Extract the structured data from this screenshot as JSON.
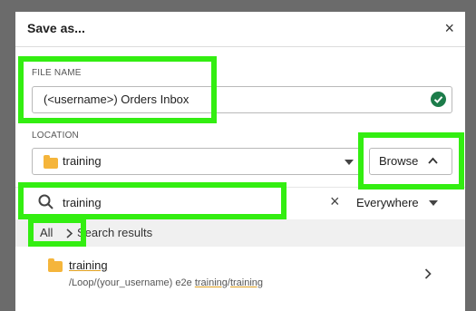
{
  "dialog": {
    "title": "Save as...",
    "close_glyph": "×"
  },
  "file_name": {
    "label": "FILE NAME",
    "value": "(<username>) Orders Inbox",
    "valid_icon": "check-circle-icon"
  },
  "location": {
    "label": "LOCATION",
    "value": "training",
    "browse_label": "Browse"
  },
  "search": {
    "query": "training",
    "clear_glyph": "×",
    "scope_value": "Everywhere"
  },
  "results": {
    "breadcrumb_all": "All",
    "breadcrumb_label": "Search results"
  },
  "result_item": {
    "name": "training",
    "path_prefix": "/Loop/(your_username) e2e ",
    "path_match1": "training",
    "path_sep": "/",
    "path_match2": "training"
  },
  "colors": {
    "highlight": "#33ee11",
    "folder": "#f5b53b",
    "valid": "#1c7c4a",
    "match_underline": "#e0a020"
  }
}
